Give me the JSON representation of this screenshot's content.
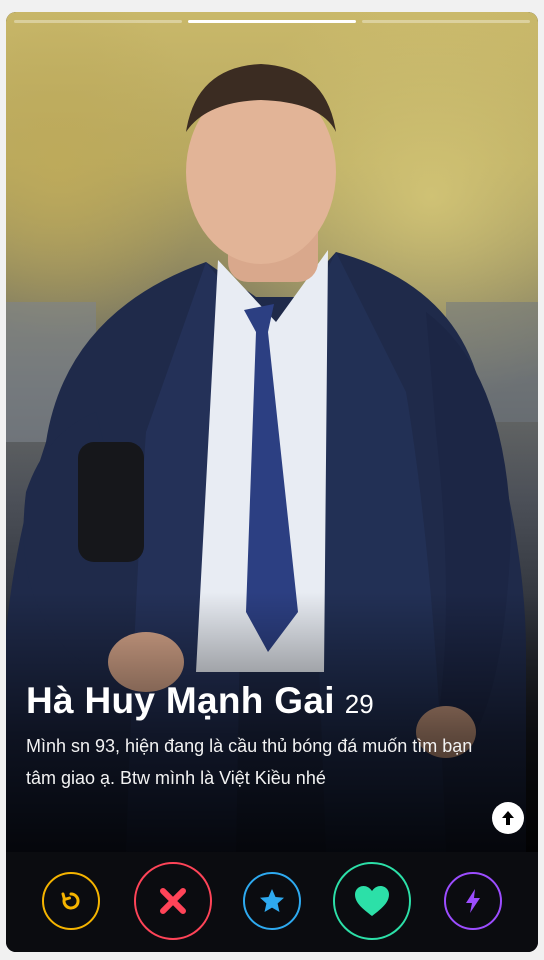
{
  "profile": {
    "name": "Hà Huy Mạnh Gai",
    "age": "29",
    "bio": "Mình sn 93, hiện đang là cầu thủ bóng đá muốn tìm bạn tâm giao ạ. Btw mình là Việt Kiều nhé",
    "photo_index": 2,
    "photo_count": 3
  },
  "icons": {
    "info": "arrow-up-icon",
    "rewind": "rewind-icon",
    "nope": "close-icon",
    "super_like": "star-icon",
    "like": "heart-icon",
    "boost": "lightning-icon"
  },
  "colors": {
    "rewind": "#f5b400",
    "nope": "#ff4458",
    "super_like": "#2eaaf0",
    "like": "#2ce0a8",
    "boost": "#9c4dff",
    "background": "#0b0c10"
  }
}
